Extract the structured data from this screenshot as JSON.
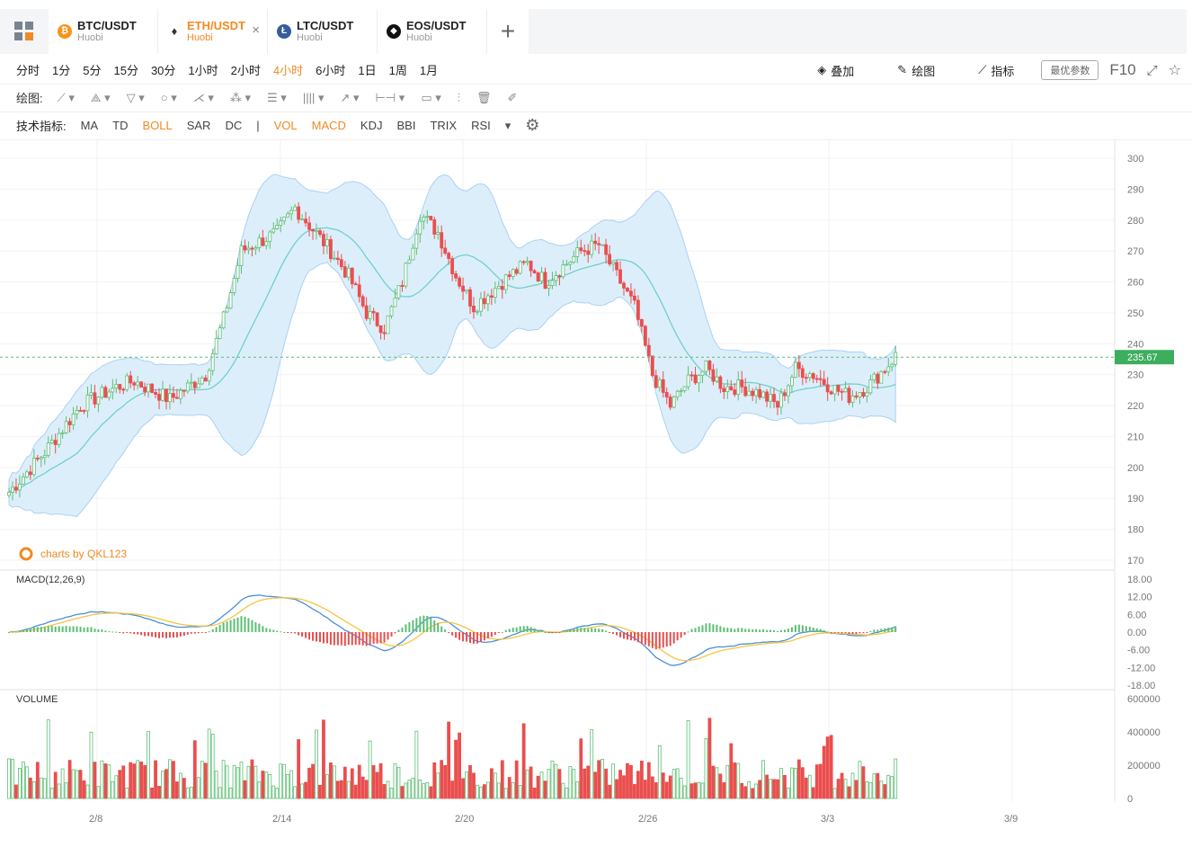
{
  "tabs": [
    {
      "symbol": "BTC/USDT",
      "exchange": "Huobi",
      "icon": "bitcoin-icon",
      "color": "#f7931a"
    },
    {
      "symbol": "ETH/USDT",
      "exchange": "Huobi",
      "icon": "ethereum-icon",
      "color": "#333333",
      "active": true,
      "close": "×"
    },
    {
      "symbol": "LTC/USDT",
      "exchange": "Huobi",
      "icon": "litecoin-icon",
      "color": "#345d9d"
    },
    {
      "symbol": "EOS/USDT",
      "exchange": "Huobi",
      "icon": "eos-icon",
      "color": "#111111"
    }
  ],
  "add_tab": "+",
  "timeframes": [
    "分时",
    "1分",
    "5分",
    "15分",
    "30分",
    "1小时",
    "2小时",
    "4小时",
    "6小时",
    "1日",
    "1周",
    "1月"
  ],
  "active_timeframe": "4小时",
  "right_tools": {
    "overlay": "叠加",
    "draw": "绘图",
    "indicator": "指标",
    "params": "最优参数",
    "f10": "F10"
  },
  "draw_label": "绘图:",
  "indicator_label": "技术指标:",
  "indicators": [
    "MA",
    "TD",
    "BOLL",
    "SAR",
    "DC",
    "|",
    "VOL",
    "MACD",
    "KDJ",
    "BBI",
    "TRIX",
    "RSI"
  ],
  "active_indicators": [
    "BOLL",
    "VOL",
    "MACD"
  ],
  "watermark": "charts by QKL123",
  "colors": {
    "up": "#5dbe74",
    "down": "#ea4e4e",
    "accent": "#f08a24",
    "band": "#c9e2f8",
    "mid": "#6fd1c9",
    "dif": "#4a90d9",
    "dea": "#f5c542"
  },
  "chart_data": {
    "type": "candlestick",
    "main": {
      "ylim": [
        170,
        300
      ],
      "yticks": [
        300,
        290,
        280,
        270,
        260,
        250,
        240,
        230,
        220,
        210,
        200,
        190,
        180,
        170
      ],
      "last_price": "235.67",
      "key_points": [
        [
          0,
          192
        ],
        [
          10,
          205
        ],
        [
          20,
          220
        ],
        [
          30,
          226
        ],
        [
          35,
          228
        ],
        [
          45,
          222
        ],
        [
          55,
          230
        ],
        [
          60,
          248
        ],
        [
          65,
          270
        ],
        [
          75,
          276
        ],
        [
          80,
          284
        ],
        [
          90,
          270
        ],
        [
          95,
          262
        ],
        [
          100,
          250
        ],
        [
          105,
          245
        ],
        [
          110,
          260
        ],
        [
          115,
          282
        ],
        [
          120,
          276
        ],
        [
          125,
          262
        ],
        [
          130,
          252
        ],
        [
          140,
          262
        ],
        [
          145,
          266
        ],
        [
          150,
          260
        ],
        [
          160,
          270
        ],
        [
          165,
          272
        ],
        [
          170,
          262
        ],
        [
          175,
          252
        ],
        [
          180,
          230
        ],
        [
          185,
          220
        ],
        [
          190,
          228
        ],
        [
          195,
          232
        ],
        [
          200,
          226
        ],
        [
          205,
          226
        ],
        [
          210,
          224
        ],
        [
          215,
          220
        ],
        [
          220,
          232
        ],
        [
          225,
          230
        ],
        [
          230,
          226
        ],
        [
          235,
          223
        ],
        [
          240,
          226
        ],
        [
          245,
          232
        ],
        [
          248,
          236
        ]
      ]
    },
    "macd": {
      "label": "MACD(12,26,9)",
      "ylim": [
        -18,
        18
      ],
      "yticks": [
        "18.00",
        "12.00",
        "6.00",
        "0.00",
        "-6.00",
        "-12.00",
        "-18.00"
      ]
    },
    "volume": {
      "label": "VOLUME",
      "ylim": [
        0,
        600000
      ],
      "yticks": [
        "600000",
        "400000",
        "200000",
        "0"
      ]
    },
    "x_tick_labels": [
      "2/8",
      "2/14",
      "2/20",
      "2/26",
      "3/3",
      "3/9"
    ]
  }
}
